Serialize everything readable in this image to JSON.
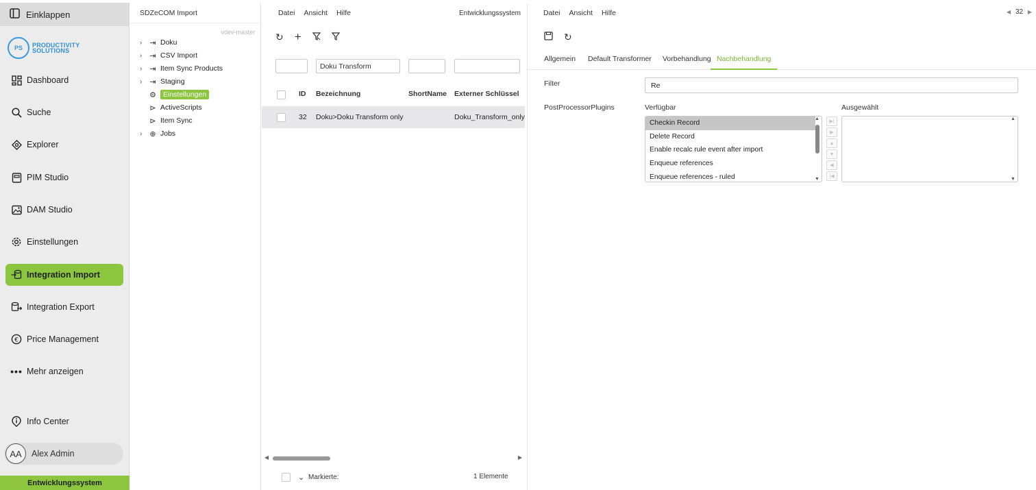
{
  "nav": {
    "collapse": "Einklappen",
    "logo": {
      "initials": "PS",
      "line1": "PRODUCTIVITY",
      "line2": "SOLUTIONS"
    },
    "items": [
      {
        "label": "Dashboard",
        "icon": "dashboard-icon"
      },
      {
        "label": "Suche",
        "icon": "search-icon"
      },
      {
        "label": "Explorer",
        "icon": "explorer-icon"
      },
      {
        "label": "PIM Studio",
        "icon": "pim-studio-icon"
      },
      {
        "label": "DAM Studio",
        "icon": "image-icon"
      },
      {
        "label": "Einstellungen",
        "icon": "gear-icon"
      },
      {
        "label": "Integration Import",
        "icon": "import-icon",
        "active": true
      },
      {
        "label": "Integration Export",
        "icon": "export-icon"
      },
      {
        "label": "Price Management",
        "icon": "euro-icon"
      },
      {
        "label": "Mehr anzeigen",
        "icon": "more-icon"
      }
    ],
    "info_center": "Info Center",
    "user": {
      "initials": "AA",
      "name": "Alex Admin"
    },
    "footer": "Entwicklungssystem",
    "accent": "#8bc63e"
  },
  "tree": {
    "title": "SDZeCOM Import",
    "branch": "vdev-master",
    "items": [
      {
        "label": "Doku"
      },
      {
        "label": "CSV Import"
      },
      {
        "label": "Item Sync Products"
      },
      {
        "label": "Staging"
      },
      {
        "label": "Einstellungen",
        "selected": true
      },
      {
        "label": "ActiveScripts"
      },
      {
        "label": "Item Sync"
      },
      {
        "label": "Jobs"
      }
    ]
  },
  "list": {
    "menu": [
      "Datei",
      "Ansicht",
      "Hilfe"
    ],
    "system": "Entwicklungssystem",
    "filters": {
      "bezeichnung": "Doku Transform"
    },
    "columns": [
      "ID",
      "Bezeichnung",
      "ShortName",
      "Externer Schlüssel"
    ],
    "rows": [
      {
        "id": "32",
        "bezeichnung": "Doku>Doku Transform only",
        "shortname": "",
        "key": "Doku_Transform_only"
      }
    ],
    "footer": {
      "marked": "Markierte:",
      "count": "1 Elemente"
    }
  },
  "detail": {
    "menu": [
      "Datei",
      "Ansicht",
      "Hilfe"
    ],
    "pager": "32",
    "tabs": [
      "Allgemein",
      "Default Transformer",
      "Vorbehandlung",
      "Nachbehandlung"
    ],
    "active_tab": "Nachbehandlung",
    "filter_label": "Filter",
    "filter_value": "Re",
    "plugins_label": "PostProcessorPlugins",
    "available_label": "Verfügbar",
    "selected_label": "Ausgewählt",
    "available": [
      "Checkin Record",
      "Delete Record",
      "Enable recalc rule event after import",
      "Enqueue references",
      "Enqueue references - ruled"
    ]
  }
}
